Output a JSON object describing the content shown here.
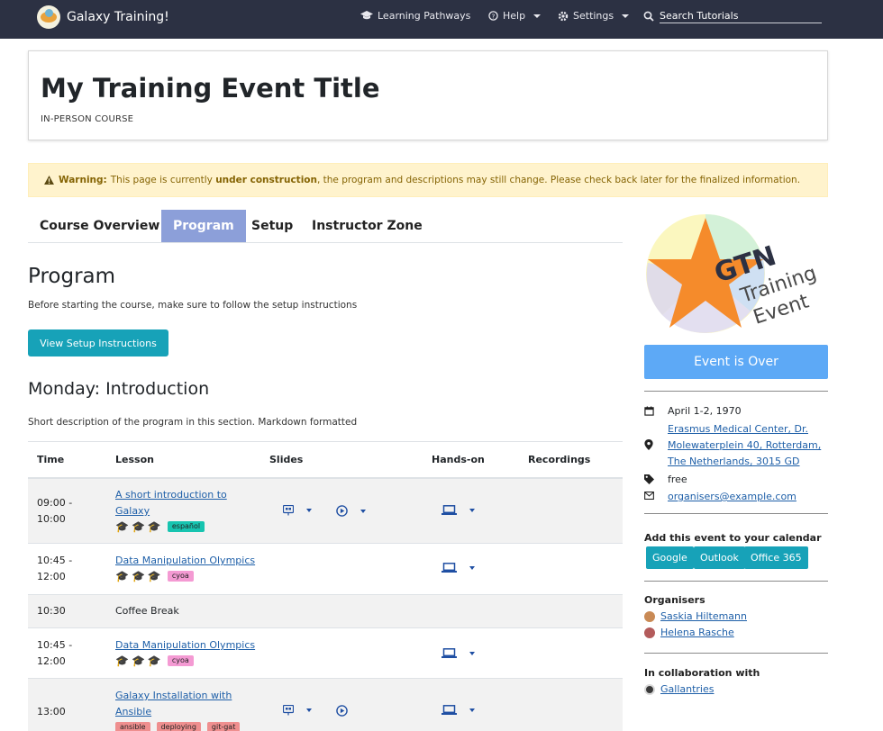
{
  "navbar": {
    "brand": "Galaxy Training!",
    "items": [
      {
        "label": "Learning Pathways"
      },
      {
        "label": "Help"
      },
      {
        "label": "Settings"
      }
    ],
    "search_placeholder": "Search Tutorials"
  },
  "event": {
    "title": "My Training Event Title",
    "type": "IN-PERSON COURSE"
  },
  "warning": {
    "label": "Warning:",
    "text_before": "This page is currently ",
    "text_bold": "under construction",
    "text_after": ", the program and descriptions may still change. Please check back later for the finalized information."
  },
  "tabs": [
    {
      "label": "Course Overview"
    },
    {
      "label": "Program",
      "active": true
    },
    {
      "label": "Setup"
    },
    {
      "label": "Instructor Zone"
    }
  ],
  "program": {
    "heading": "Program",
    "setup_note": "Before starting the course, make sure to follow the setup instructions",
    "setup_button": "View Setup Instructions",
    "section_heading": "Monday: Introduction",
    "section_desc": "Short description of the program in this section. Markdown formatted"
  },
  "table": {
    "headers": [
      "Time",
      "Lesson",
      "Slides",
      "Hands-on",
      "Recordings"
    ],
    "rows": [
      {
        "time1": "09:00 -",
        "time2": "10:00",
        "lesson": "A short introduction to Galaxy",
        "level": 1,
        "tags": [
          "español"
        ],
        "tag_colors": [
          "teal"
        ],
        "slides": true,
        "video": true,
        "handson": true
      },
      {
        "time1": "10:45 -",
        "time2": "12:00",
        "lesson": "Data Manipulation Olympics",
        "level": 1,
        "tags": [
          "cyoa"
        ],
        "tag_colors": [
          "pink"
        ],
        "slides": false,
        "video": false,
        "handson": true
      },
      {
        "time1": "10:30",
        "time2": "",
        "lesson": "Coffee Break",
        "plain": true
      },
      {
        "time1": "10:45 -",
        "time2": "12:00",
        "lesson": "Data Manipulation Olympics",
        "level": 1,
        "tags": [
          "cyoa"
        ],
        "tag_colors": [
          "pink"
        ],
        "slides": false,
        "video": false,
        "handson": true
      },
      {
        "time1": "13:00",
        "time2": "",
        "lesson": "Galaxy Installation with Ansible",
        "level": 0,
        "tags": [
          "ansible",
          "deploying",
          "git-gat"
        ],
        "tag_colors": [
          "red",
          "red",
          "red"
        ],
        "slides": true,
        "video": true,
        "handson": true
      }
    ]
  },
  "sidebar": {
    "logo_text": {
      "gtn": "GTN",
      "training": "Training",
      "event": "Event"
    },
    "status_button": "Event is Over",
    "date": "April 1-2, 1970",
    "location_lines": [
      "Erasmus Medical Center, Dr.",
      "Molewaterplein 40, Rotterdam,",
      "The Netherlands, 3015 GD"
    ],
    "cost": "free",
    "email": "organisers@example.com",
    "calendar_label": "Add this event to your calendar",
    "calendar_buttons": [
      "Google",
      "Outlook",
      "Office 365"
    ],
    "organisers_label": "Organisers",
    "organisers": [
      "Saskia Hiltemann",
      "Helena Rasche"
    ],
    "collab_label": "In collaboration with",
    "collaborators": [
      "Gallantries"
    ]
  },
  "colors": {
    "navbar": "#2c3143",
    "tab_active": "#8c9fd9",
    "info_button": "#17a2b8",
    "status_button": "#5da9f6",
    "link": "#1e5fa8"
  }
}
